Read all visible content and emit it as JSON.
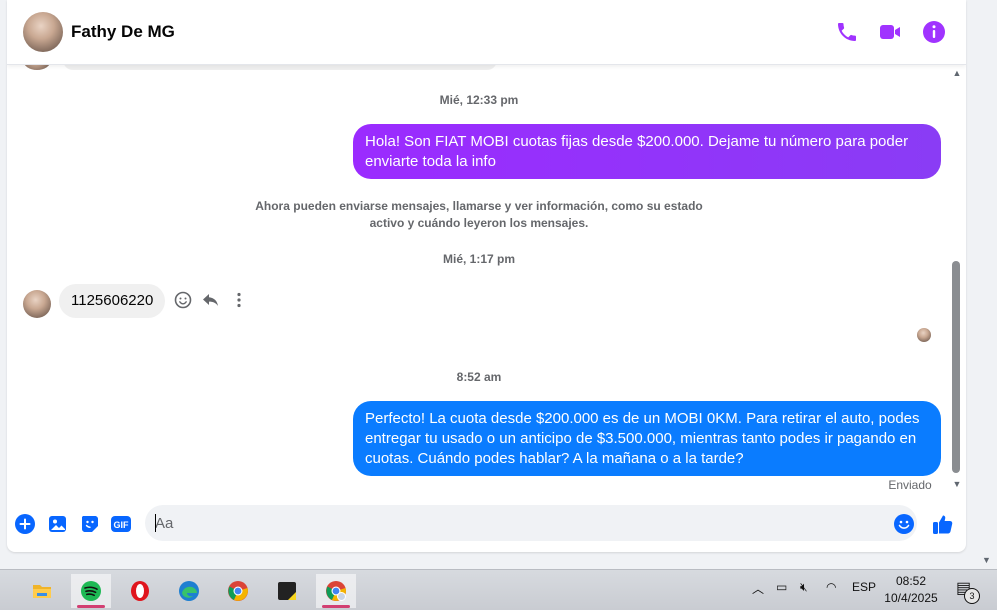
{
  "header": {
    "contact_name": "Fathy De MG",
    "icons": [
      "phone-icon",
      "video-camera-icon",
      "info-icon"
    ]
  },
  "messages": {
    "timestamp_1": "Mié, 12:33 pm",
    "outgoing_1": "Hola! Son  FIAT MOBI cuotas fijas desde $200.000. Dejame tu número para poder enviarte toda la info",
    "system_note_line1": "Ahora pueden enviarse mensajes, llamarse y ver información, como su estado",
    "system_note_line2": "activo y cuándo leyeron los mensajes.",
    "timestamp_2": "Mié, 1:17 pm",
    "incoming_1": "1125606220",
    "timestamp_3": "8:52 am",
    "outgoing_2": "Perfecto! La cuota desde $200.000 es de un MOBI 0KM. Para retirar el auto, podes entregar tu usado o un anticipo de $3.500.000, mientras tanto podes ir pagando en cuotas. Cuándo podes hablar? A la mañana o a la tarde?",
    "status": "Enviado"
  },
  "composer": {
    "placeholder": "Aa",
    "icons": [
      "plus-icon",
      "image-icon",
      "sticker-icon",
      "gif-icon",
      "emoji-icon",
      "like-icon"
    ],
    "gif_label": "GIF"
  },
  "taskbar": {
    "apps": [
      "file-explorer-icon",
      "spotify-icon",
      "opera-icon",
      "edge-icon",
      "chrome-icon",
      "sticky-notes-icon",
      "chrome-profile-icon"
    ],
    "language": "ESP",
    "time": "08:52",
    "date": "10/4/2025",
    "notification_count": "3"
  },
  "colors": {
    "purple_bubble": "#9b2bff",
    "blue_bubble": "#0a7cff",
    "messenger_accent": "#a033ff",
    "composer_accent": "#0866ff"
  }
}
